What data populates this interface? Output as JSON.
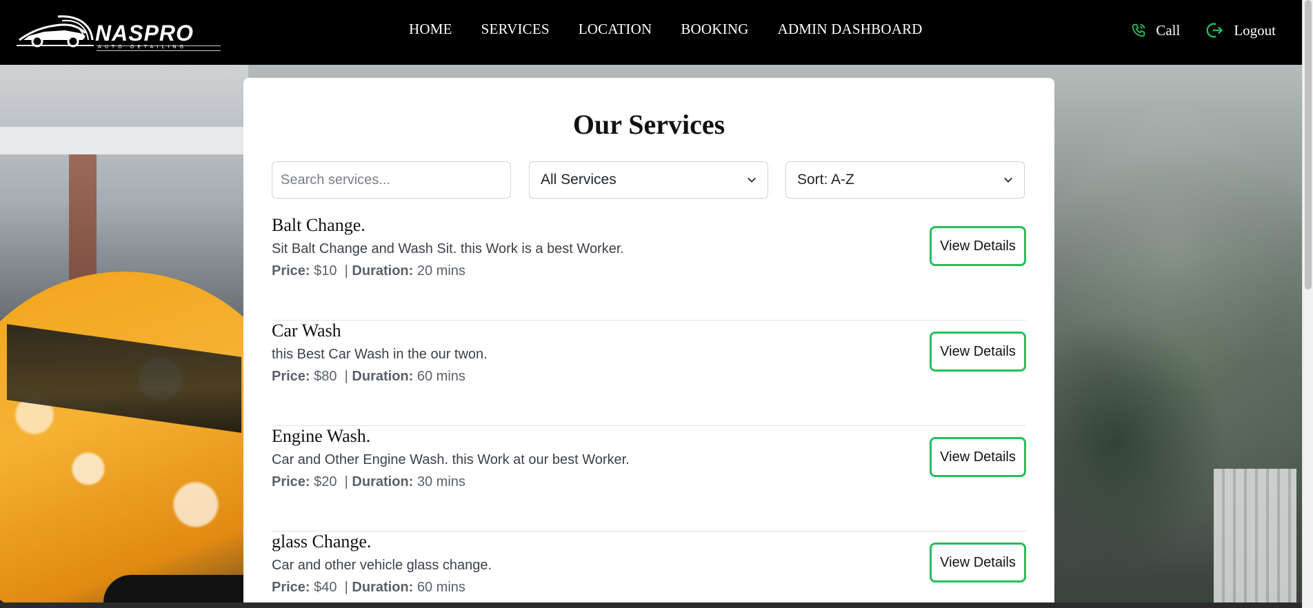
{
  "brand": {
    "name": "NASPRO",
    "tagline": "AUTO DETAILING"
  },
  "nav": {
    "links": [
      "HOME",
      "SERVICES",
      "LOCATION",
      "BOOKING",
      "ADMIN DASHBOARD"
    ],
    "call_label": "Call",
    "logout_label": "Logout",
    "accent_color": "#22c05a"
  },
  "page": {
    "title": "Our Services",
    "search_placeholder": "Search services...",
    "filter_selected": "All Services",
    "sort_selected": "Sort: A-Z"
  },
  "labels": {
    "price": "Price:",
    "duration": "Duration:",
    "separator": "|",
    "view_details": "View Details"
  },
  "services": [
    {
      "name": "Balt Change.",
      "description": "Sit Balt Change and Wash Sit. this Work is a best Worker.",
      "price": "$10",
      "duration": "20 mins"
    },
    {
      "name": "Car Wash",
      "description": "this Best Car Wash in the our twon.",
      "price": "$80",
      "duration": "60 mins"
    },
    {
      "name": "Engine Wash.",
      "description": "Car and Other Engine Wash. this Work at our best Worker.",
      "price": "$20",
      "duration": "30 mins"
    },
    {
      "name": "glass Change.",
      "description": "Car and other vehicle glass change.",
      "price": "$40",
      "duration": "60 mins"
    }
  ]
}
